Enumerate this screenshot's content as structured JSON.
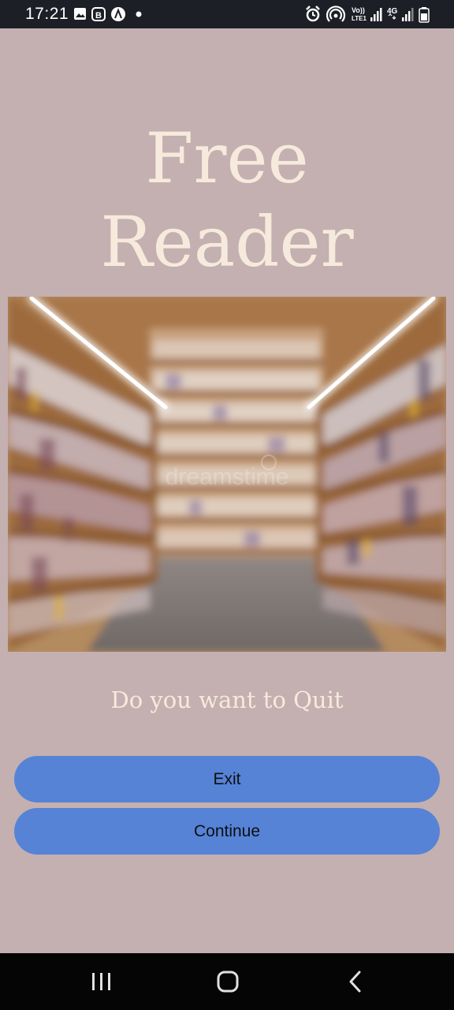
{
  "status_bar": {
    "time": "17:21",
    "left_icons": [
      "image-icon",
      "b-badge-icon",
      "lambda-badge-icon",
      "dot-icon"
    ],
    "right_icons": [
      "alarm-icon",
      "hotspot-icon",
      "volte-icon",
      "signal-icon",
      "4g-icon",
      "signal-2-icon",
      "battery-icon"
    ],
    "volte_label": "Vo)) LTE1",
    "network_label": "4G"
  },
  "app": {
    "title_line1": "Free",
    "title_line2": "Reader",
    "prompt": "Do you want to Quit",
    "exit_label": "Exit",
    "continue_label": "Continue"
  },
  "image": {
    "subject": "library-bookshelves",
    "watermark": "dreamstime"
  },
  "nav_bar": {
    "buttons": [
      "recent-apps-icon",
      "home-icon",
      "back-icon"
    ]
  },
  "colors": {
    "background": "#c4b0b0",
    "title": "#f6eadd",
    "button": "#5683d6",
    "button_text": "#0d0f14",
    "status_bar": "#1d1f26",
    "nav_bar": "#050505"
  }
}
